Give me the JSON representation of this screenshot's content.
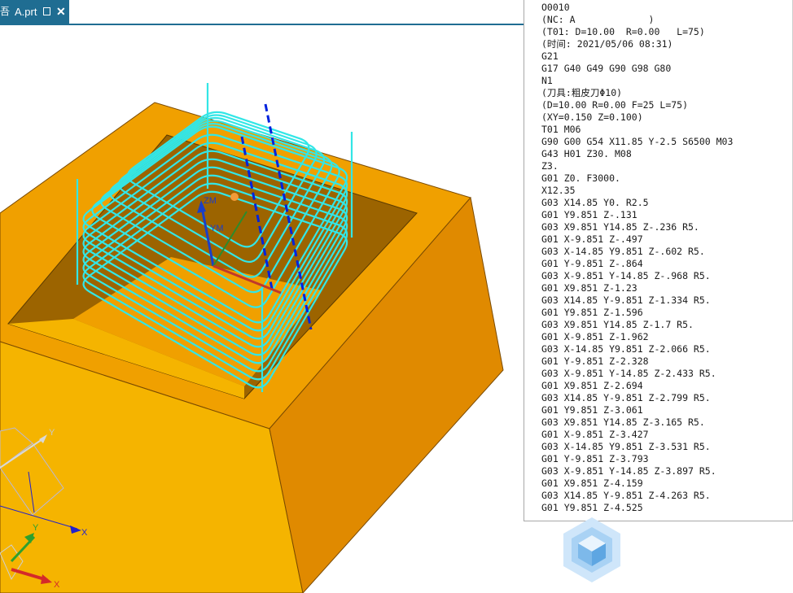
{
  "tab": {
    "glyph": "吾",
    "title": "A.prt",
    "save_icon": "save-icon",
    "close_label": "✕"
  },
  "colors": {
    "tab_bg": "#1f6d92",
    "part_top": "#f0a000",
    "part_side_left": "#f5b400",
    "part_side_right": "#e08a00",
    "pocket_wall": "#9c6400",
    "pocket_floor": "#f0a000",
    "toolpath": "#33e6e6",
    "tool_axis": "#0022dd"
  },
  "triad": {
    "wcs_labels": {
      "y": "Y",
      "x": "X"
    },
    "absolute_labels": {
      "y": "Y",
      "x": "X"
    },
    "tool_labels": {
      "zm": "ZM",
      "ym": "YM"
    }
  },
  "nc_program": {
    "lines": [
      "O0010",
      "(NC: A             )",
      "(T01: D=10.00  R=0.00   L=75)",
      "(时间: 2021/05/06 08:31)",
      "G21",
      "G17 G40 G49 G90 G98 G80",
      "N1",
      "(刀具:粗皮刀Φ10)",
      "(D=10.00 R=0.00 F=25 L=75)",
      "(XY=0.150 Z=0.100)",
      "T01 M06",
      "G90 G00 G54 X11.85 Y-2.5 S6500 M03",
      "G43 H01 Z30. M08",
      "Z3.",
      "G01 Z0. F3000.",
      "X12.35",
      "G03 X14.85 Y0. R2.5",
      "G01 Y9.851 Z-.131",
      "G03 X9.851 Y14.85 Z-.236 R5.",
      "G01 X-9.851 Z-.497",
      "G03 X-14.85 Y9.851 Z-.602 R5.",
      "G01 Y-9.851 Z-.864",
      "G03 X-9.851 Y-14.85 Z-.968 R5.",
      "G01 X9.851 Z-1.23",
      "G03 X14.85 Y-9.851 Z-1.334 R5.",
      "G01 Y9.851 Z-1.596",
      "G03 X9.851 Y14.85 Z-1.7 R5.",
      "G01 X-9.851 Z-1.962",
      "G03 X-14.85 Y9.851 Z-2.066 R5.",
      "G01 Y-9.851 Z-2.328",
      "G03 X-9.851 Y-14.85 Z-2.433 R5.",
      "G01 X9.851 Z-2.694",
      "G03 X14.85 Y-9.851 Z-2.799 R5.",
      "G01 Y9.851 Z-3.061",
      "G03 X9.851 Y14.85 Z-3.165 R5.",
      "G01 X-9.851 Z-3.427",
      "G03 X-14.85 Y9.851 Z-3.531 R5.",
      "G01 Y-9.851 Z-3.793",
      "G03 X-9.851 Y-14.85 Z-3.897 R5.",
      "G01 X9.851 Z-4.159",
      "G03 X14.85 Y-9.851 Z-4.263 R5.",
      "G01 Y9.851 Z-4.525"
    ]
  },
  "watermark_icon": "cube-hexagon-logo-icon"
}
